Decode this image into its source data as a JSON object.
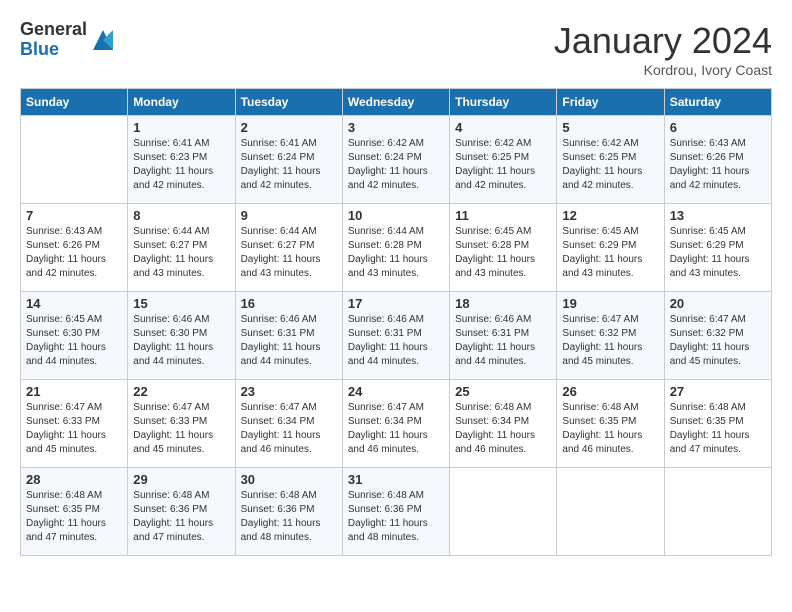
{
  "header": {
    "logo_line1": "General",
    "logo_line2": "Blue",
    "month": "January 2024",
    "location": "Kordrou, Ivory Coast"
  },
  "weekdays": [
    "Sunday",
    "Monday",
    "Tuesday",
    "Wednesday",
    "Thursday",
    "Friday",
    "Saturday"
  ],
  "weeks": [
    [
      {
        "day": "",
        "info": ""
      },
      {
        "day": "1",
        "info": "Sunrise: 6:41 AM\nSunset: 6:23 PM\nDaylight: 11 hours\nand 42 minutes."
      },
      {
        "day": "2",
        "info": "Sunrise: 6:41 AM\nSunset: 6:24 PM\nDaylight: 11 hours\nand 42 minutes."
      },
      {
        "day": "3",
        "info": "Sunrise: 6:42 AM\nSunset: 6:24 PM\nDaylight: 11 hours\nand 42 minutes."
      },
      {
        "day": "4",
        "info": "Sunrise: 6:42 AM\nSunset: 6:25 PM\nDaylight: 11 hours\nand 42 minutes."
      },
      {
        "day": "5",
        "info": "Sunrise: 6:42 AM\nSunset: 6:25 PM\nDaylight: 11 hours\nand 42 minutes."
      },
      {
        "day": "6",
        "info": "Sunrise: 6:43 AM\nSunset: 6:26 PM\nDaylight: 11 hours\nand 42 minutes."
      }
    ],
    [
      {
        "day": "7",
        "info": "Sunrise: 6:43 AM\nSunset: 6:26 PM\nDaylight: 11 hours\nand 42 minutes."
      },
      {
        "day": "8",
        "info": "Sunrise: 6:44 AM\nSunset: 6:27 PM\nDaylight: 11 hours\nand 43 minutes."
      },
      {
        "day": "9",
        "info": "Sunrise: 6:44 AM\nSunset: 6:27 PM\nDaylight: 11 hours\nand 43 minutes."
      },
      {
        "day": "10",
        "info": "Sunrise: 6:44 AM\nSunset: 6:28 PM\nDaylight: 11 hours\nand 43 minutes."
      },
      {
        "day": "11",
        "info": "Sunrise: 6:45 AM\nSunset: 6:28 PM\nDaylight: 11 hours\nand 43 minutes."
      },
      {
        "day": "12",
        "info": "Sunrise: 6:45 AM\nSunset: 6:29 PM\nDaylight: 11 hours\nand 43 minutes."
      },
      {
        "day": "13",
        "info": "Sunrise: 6:45 AM\nSunset: 6:29 PM\nDaylight: 11 hours\nand 43 minutes."
      }
    ],
    [
      {
        "day": "14",
        "info": "Sunrise: 6:45 AM\nSunset: 6:30 PM\nDaylight: 11 hours\nand 44 minutes."
      },
      {
        "day": "15",
        "info": "Sunrise: 6:46 AM\nSunset: 6:30 PM\nDaylight: 11 hours\nand 44 minutes."
      },
      {
        "day": "16",
        "info": "Sunrise: 6:46 AM\nSunset: 6:31 PM\nDaylight: 11 hours\nand 44 minutes."
      },
      {
        "day": "17",
        "info": "Sunrise: 6:46 AM\nSunset: 6:31 PM\nDaylight: 11 hours\nand 44 minutes."
      },
      {
        "day": "18",
        "info": "Sunrise: 6:46 AM\nSunset: 6:31 PM\nDaylight: 11 hours\nand 44 minutes."
      },
      {
        "day": "19",
        "info": "Sunrise: 6:47 AM\nSunset: 6:32 PM\nDaylight: 11 hours\nand 45 minutes."
      },
      {
        "day": "20",
        "info": "Sunrise: 6:47 AM\nSunset: 6:32 PM\nDaylight: 11 hours\nand 45 minutes."
      }
    ],
    [
      {
        "day": "21",
        "info": "Sunrise: 6:47 AM\nSunset: 6:33 PM\nDaylight: 11 hours\nand 45 minutes."
      },
      {
        "day": "22",
        "info": "Sunrise: 6:47 AM\nSunset: 6:33 PM\nDaylight: 11 hours\nand 45 minutes."
      },
      {
        "day": "23",
        "info": "Sunrise: 6:47 AM\nSunset: 6:34 PM\nDaylight: 11 hours\nand 46 minutes."
      },
      {
        "day": "24",
        "info": "Sunrise: 6:47 AM\nSunset: 6:34 PM\nDaylight: 11 hours\nand 46 minutes."
      },
      {
        "day": "25",
        "info": "Sunrise: 6:48 AM\nSunset: 6:34 PM\nDaylight: 11 hours\nand 46 minutes."
      },
      {
        "day": "26",
        "info": "Sunrise: 6:48 AM\nSunset: 6:35 PM\nDaylight: 11 hours\nand 46 minutes."
      },
      {
        "day": "27",
        "info": "Sunrise: 6:48 AM\nSunset: 6:35 PM\nDaylight: 11 hours\nand 47 minutes."
      }
    ],
    [
      {
        "day": "28",
        "info": "Sunrise: 6:48 AM\nSunset: 6:35 PM\nDaylight: 11 hours\nand 47 minutes."
      },
      {
        "day": "29",
        "info": "Sunrise: 6:48 AM\nSunset: 6:36 PM\nDaylight: 11 hours\nand 47 minutes."
      },
      {
        "day": "30",
        "info": "Sunrise: 6:48 AM\nSunset: 6:36 PM\nDaylight: 11 hours\nand 48 minutes."
      },
      {
        "day": "31",
        "info": "Sunrise: 6:48 AM\nSunset: 6:36 PM\nDaylight: 11 hours\nand 48 minutes."
      },
      {
        "day": "",
        "info": ""
      },
      {
        "day": "",
        "info": ""
      },
      {
        "day": "",
        "info": ""
      }
    ]
  ]
}
